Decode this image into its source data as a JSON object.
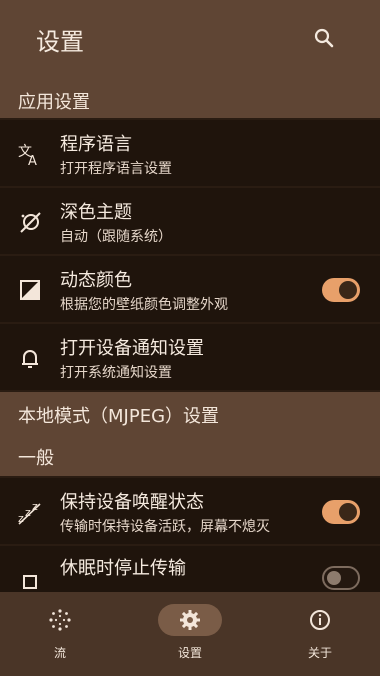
{
  "header": {
    "title": "设置",
    "search_icon": "search-icon"
  },
  "sections": {
    "app": {
      "label": "应用设置"
    },
    "local": {
      "label": "本地模式（MJPEG）设置"
    },
    "general": {
      "label": "一般"
    }
  },
  "rows": {
    "language": {
      "title": "程序语言",
      "subtitle": "打开程序语言设置",
      "icon": "translate-icon"
    },
    "theme": {
      "title": "深色主题",
      "subtitle": "自动（跟随系统）",
      "icon": "dark-mode-icon"
    },
    "dynamic_color": {
      "title": "动态颜色",
      "subtitle": "根据您的壁纸颜色调整外观",
      "icon": "palette-icon",
      "toggle_on": true
    },
    "notification": {
      "title": "打开设备通知设置",
      "subtitle": "打开系统通知设置",
      "icon": "bell-icon"
    },
    "keep_awake": {
      "title": "保持设备唤醒状态",
      "subtitle": "传输时保持设备活跃，屏幕不熄灭",
      "icon": "sleep-icon",
      "toggle_on": true
    },
    "stop_on_sleep": {
      "title": "休眠时停止传输",
      "subtitle": "",
      "icon": "stop-icon",
      "toggle_on": false
    }
  },
  "nav": {
    "stream": {
      "label": "流",
      "icon": "stream-icon"
    },
    "settings": {
      "label": "设置",
      "icon": "gear-icon",
      "active": true
    },
    "about": {
      "label": "关于",
      "icon": "info-icon"
    }
  }
}
